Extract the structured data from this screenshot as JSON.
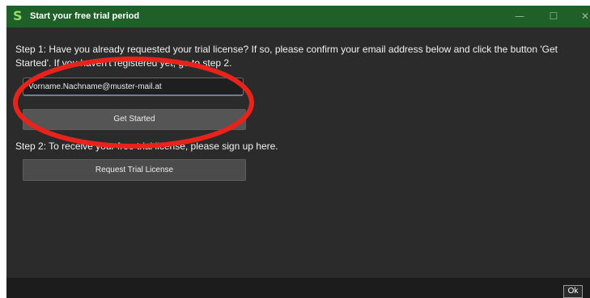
{
  "window": {
    "title": "Start your free trial period",
    "logo_letter": "S",
    "controls": {
      "minimize": "—",
      "maximize": "☐",
      "close": "✕"
    }
  },
  "step1": {
    "text": "Step 1: Have you already requested your trial license? If so, please confirm your email address below and click the button 'Get Started'. If you haven't registered yet, go to step 2."
  },
  "email_input": {
    "value": "Vorname.Nachname@muster-mail.at"
  },
  "get_started_button": {
    "label": "Get Started"
  },
  "step2": {
    "text": "Step 2: To receive your free trial license, please sign up here."
  },
  "request_button": {
    "label": "Request Trial License"
  },
  "footer": {
    "ok_label": "Ok"
  },
  "colors": {
    "titlebar": "#1f5f28",
    "window_bg": "#2b2b2b",
    "annotation_red": "#e8231c"
  }
}
